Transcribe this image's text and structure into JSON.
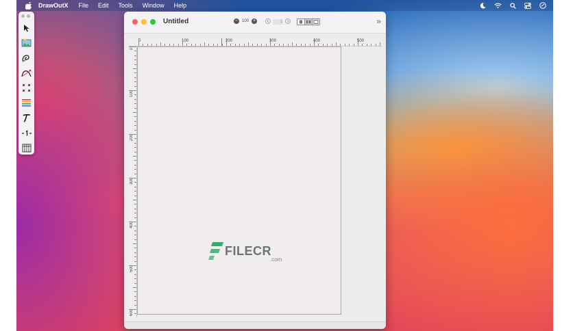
{
  "menubar": {
    "app_name": "DrawOutX",
    "menus": [
      "File",
      "Edit",
      "Tools",
      "Window",
      "Help"
    ]
  },
  "window": {
    "title": "Untitled",
    "zoom_value": "100",
    "page_number": "1",
    "expand_glyph": "»"
  },
  "ruler": {
    "horizontal_labels": [
      "0",
      "100",
      "200",
      "300",
      "400",
      "500"
    ],
    "vertical_labels": [
      "0",
      "100",
      "200",
      "300",
      "400",
      "500",
      "600"
    ]
  },
  "tools": [
    "select-arrow-icon",
    "image-tool-icon",
    "freehand-tool-icon",
    "bezier-tool-icon",
    "selection-handles-icon",
    "lines-tool-icon",
    "text-tool-icon",
    "number-tool-icon",
    "table-tool-icon"
  ],
  "watermark": {
    "brand": "FILECR",
    "suffix": ".com"
  },
  "colors": {
    "traffic_close": "#fe5f57",
    "traffic_minimize": "#febc2e",
    "traffic_zoom": "#28c840",
    "ruler_marker": "#5b7bd8",
    "watermark_green": "#2fae6e"
  }
}
